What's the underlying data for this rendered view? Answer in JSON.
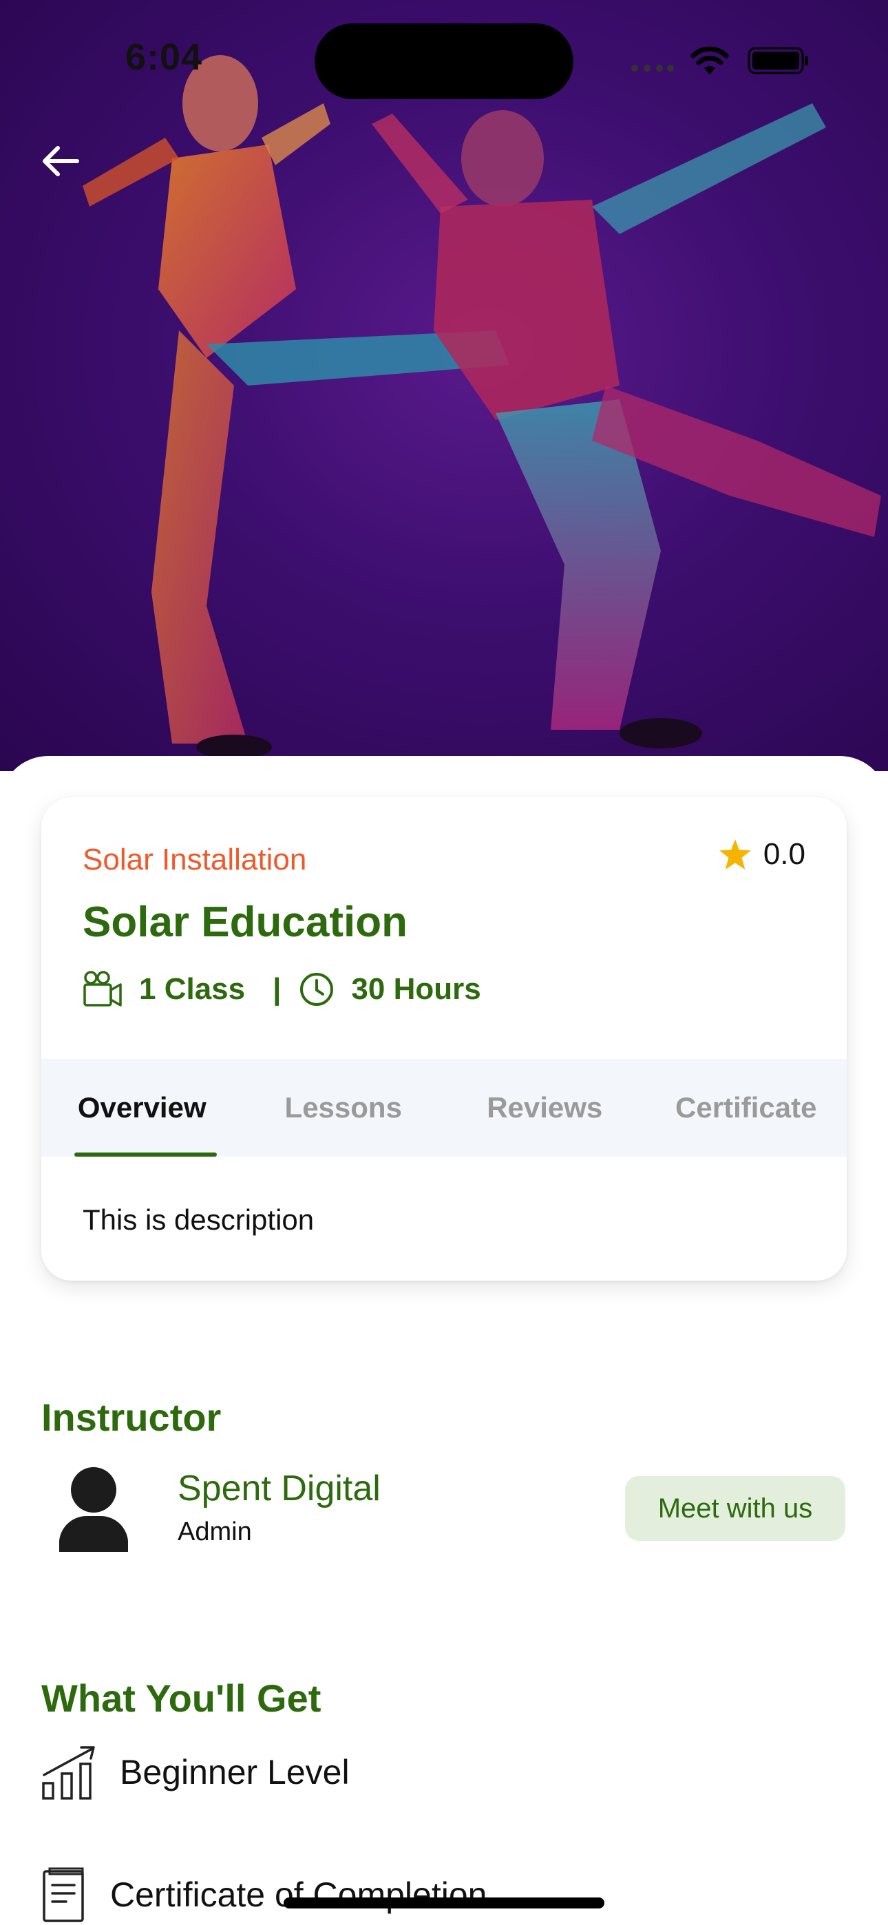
{
  "status_bar": {
    "time": "6:04"
  },
  "course": {
    "category": "Solar Installation",
    "rating": "0.0",
    "title": "Solar Education",
    "classes": "1 Class",
    "separator": "|",
    "duration": "30 Hours",
    "description": "This is description"
  },
  "tabs": [
    {
      "label": "Overview",
      "active": true
    },
    {
      "label": "Lessons",
      "active": false
    },
    {
      "label": "Reviews",
      "active": false
    },
    {
      "label": "Certificate",
      "active": false
    }
  ],
  "instructor": {
    "section_title": "Instructor",
    "name": "Spent Digital",
    "role": "Admin",
    "meet_button": "Meet with us"
  },
  "what_you_get": {
    "section_title": "What You'll Get",
    "items": [
      {
        "label": "Beginner Level",
        "icon": "bar-chart-icon"
      },
      {
        "label": "Certificate of Completion",
        "icon": "certificate-icon"
      }
    ]
  },
  "colors": {
    "brand_green": "#2d6a0e",
    "category_orange": "#f0592a",
    "star": "#f5b400",
    "meet_button_bg": "#e3eedd"
  }
}
